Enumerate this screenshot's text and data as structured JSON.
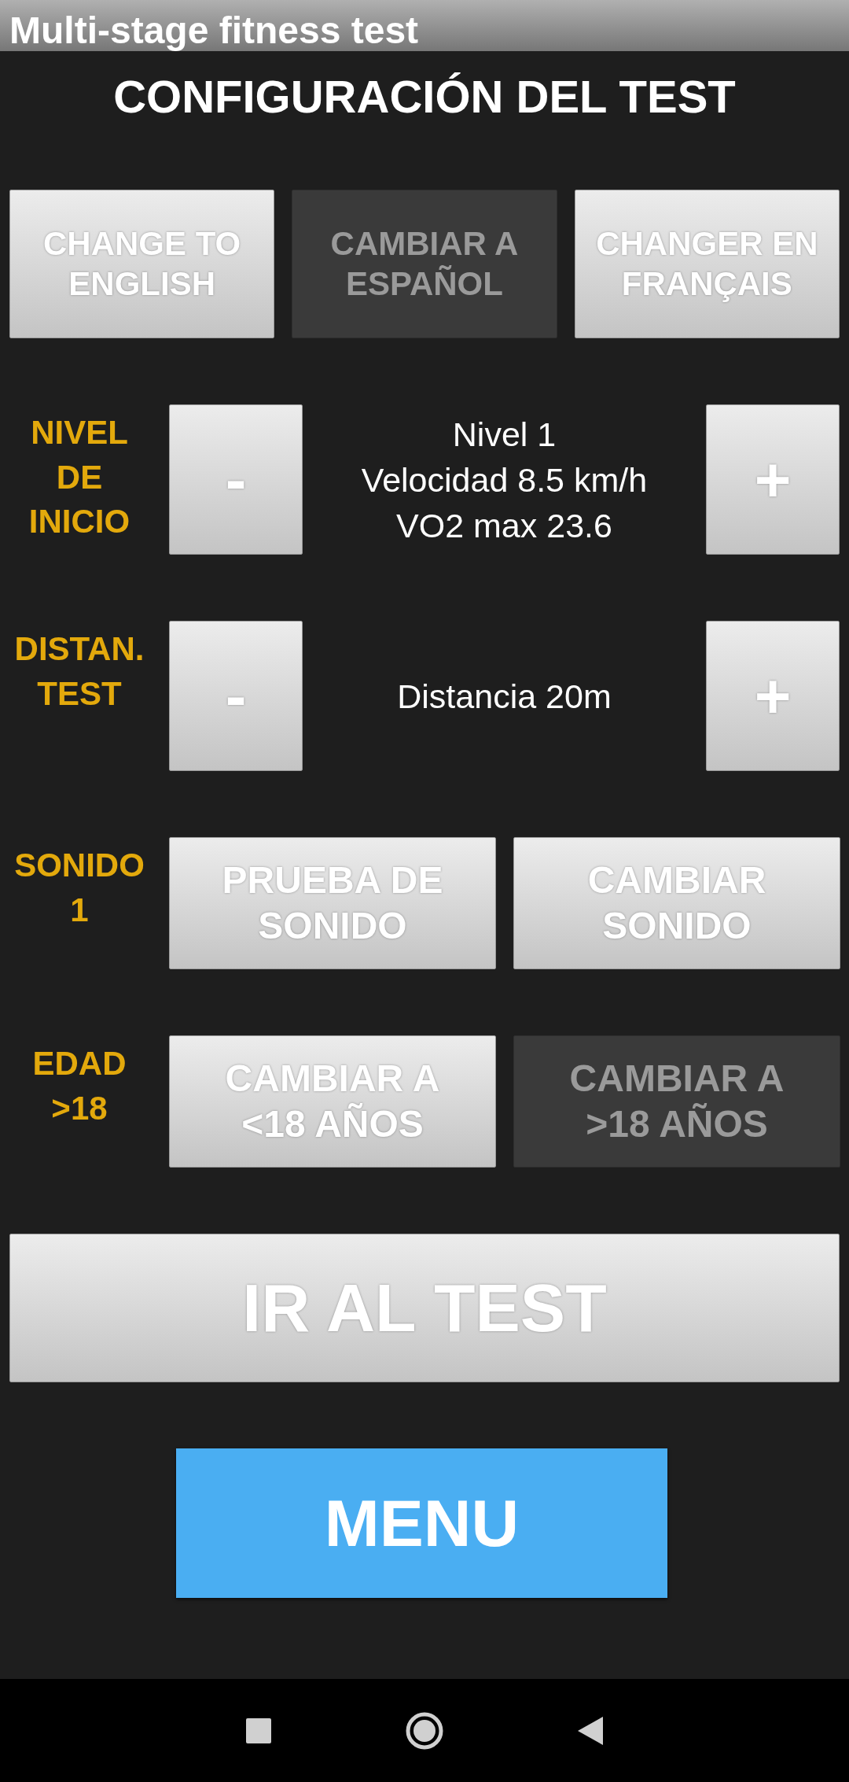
{
  "window": {
    "title": "Multi-stage fitness test"
  },
  "header": "CONFIGURACIÓN DEL TEST",
  "language_buttons": [
    {
      "label": "CHANGE TO\nENGLISH",
      "disabled": false
    },
    {
      "label": "CAMBIAR A\nESPAÑOL",
      "disabled": true
    },
    {
      "label": "CHANGER EN\nFRANÇAIS",
      "disabled": false
    }
  ],
  "settings": [
    {
      "kind": "stepper",
      "label": "NIVEL\nDE\nINICIO",
      "minus": "-",
      "plus": "+",
      "info": [
        "Nivel 1",
        "Velocidad 8.5 km/h",
        "VO2 max 23.6"
      ]
    },
    {
      "kind": "stepper",
      "label": "DISTAN.\nTEST",
      "minus": "-",
      "plus": "+",
      "info": [
        "Distancia 20m"
      ]
    },
    {
      "kind": "buttons",
      "label": "SONIDO\n1",
      "buttons": [
        {
          "label": "PRUEBA DE\nSONIDO",
          "disabled": false
        },
        {
          "label": "CAMBIAR\nSONIDO",
          "disabled": false
        }
      ]
    },
    {
      "kind": "buttons",
      "label": "EDAD\n>18",
      "buttons": [
        {
          "label": "CAMBIAR A\n<18 AÑOS",
          "disabled": false
        },
        {
          "label": "CAMBIAR A\n>18 AÑOS",
          "disabled": true
        }
      ]
    }
  ],
  "go_button": "IR AL TEST",
  "menu_button": "MENU"
}
